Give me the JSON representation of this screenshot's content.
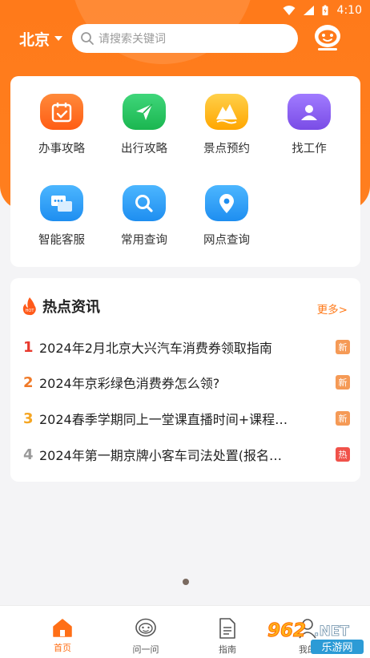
{
  "status_bar": {
    "time": "4:10"
  },
  "header": {
    "city": "北京",
    "search_placeholder": "请搜索关键词",
    "icons": [
      "location-caret-icon",
      "search-icon",
      "robot-assistant-icon"
    ]
  },
  "services": [
    {
      "label": "办事攻略",
      "icon": "calendar-check-icon",
      "color": "#ff6f1e"
    },
    {
      "label": "出行攻略",
      "icon": "paper-plane-icon",
      "color": "#23c45e"
    },
    {
      "label": "景点预约",
      "icon": "mountain-scenery-icon",
      "color": "#ffb71c"
    },
    {
      "label": "找工作",
      "icon": "person-icon",
      "color": "#8a5cf0"
    },
    {
      "label": "智能客服",
      "icon": "chat-bubbles-icon",
      "color": "#2fa4ff"
    },
    {
      "label": "常用查询",
      "icon": "magnifier-icon",
      "color": "#2fa4ff"
    },
    {
      "label": "网点查询",
      "icon": "map-pin-icon",
      "color": "#2fa4ff"
    }
  ],
  "hot_news": {
    "title": "热点资讯",
    "more": "更多>",
    "items": [
      {
        "rank": "1",
        "text": "2024年2月北京大兴汽车消费券领取指南",
        "badge": "新",
        "rank_color": "#e83a2e",
        "badge_color": "#f59a56"
      },
      {
        "rank": "2",
        "text": "2024年京彩绿色消费券怎么领?",
        "badge": "新",
        "rank_color": "#f07a28",
        "badge_color": "#f59a56"
      },
      {
        "rank": "3",
        "text": "2024春季学期同上一堂课直播时间+课程…",
        "badge": "新",
        "rank_color": "#f5a623",
        "badge_color": "#f59a56"
      },
      {
        "rank": "4",
        "text": "2024年第一期京牌小客车司法处置(报名…",
        "badge": "热",
        "rank_color": "#9a9a9a",
        "badge_color": "#f0524a"
      }
    ]
  },
  "bottom_nav": {
    "items": [
      {
        "label": "首页",
        "icon": "home-icon",
        "active": true
      },
      {
        "label": "问一问",
        "icon": "robot-face-icon",
        "active": false
      },
      {
        "label": "指南",
        "icon": "document-icon",
        "active": false
      },
      {
        "label": "我的",
        "icon": "user-icon",
        "active": false
      }
    ]
  },
  "watermark": {
    "text_top": "962.NET",
    "text_bottom": "乐游网"
  },
  "colors": {
    "brand": "#ff7a1a",
    "accent_text": "#ff6f16"
  }
}
